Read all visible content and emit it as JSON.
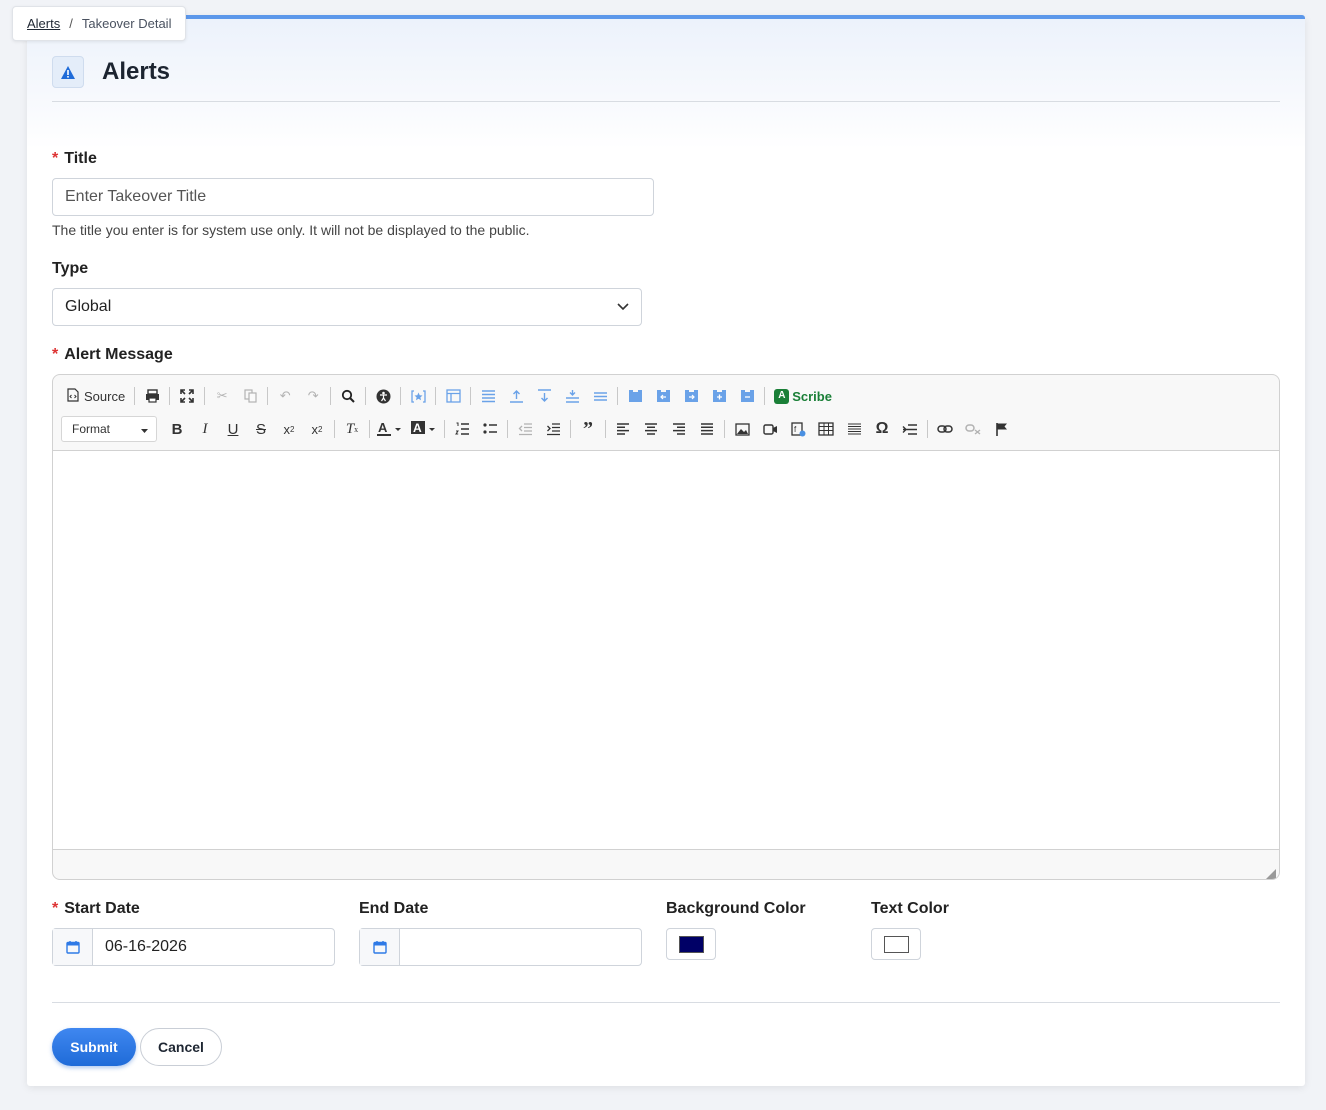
{
  "breadcrumb": {
    "parent": "Alerts",
    "separator": "/",
    "current": "Takeover Detail"
  },
  "header": {
    "title": "Alerts",
    "icon": "warning-icon"
  },
  "form": {
    "title_field": {
      "required_mark": "*",
      "label": "Title",
      "placeholder": "Enter Takeover Title",
      "value": "",
      "help": "The title you enter is for system use only. It will not be displayed to the public."
    },
    "type_field": {
      "label": "Type",
      "value": "Global"
    },
    "message_field": {
      "required_mark": "*",
      "label": "Alert Message"
    },
    "start_date": {
      "required_mark": "*",
      "label": "Start Date",
      "value": "06-16-2026"
    },
    "end_date": {
      "label": "End Date",
      "value": ""
    },
    "background_color": {
      "label": "Background Color",
      "value": "#000066"
    },
    "text_color": {
      "label": "Text Color",
      "value": "#ffffff"
    }
  },
  "editor": {
    "source_label": "Source",
    "scribe_label": "Scribe",
    "format_label": "Format"
  },
  "buttons": {
    "submit": "Submit",
    "cancel": "Cancel"
  },
  "colors": {
    "accent": "#2f7ae6",
    "required": "#dd3333",
    "scribe": "#1a7f37"
  }
}
